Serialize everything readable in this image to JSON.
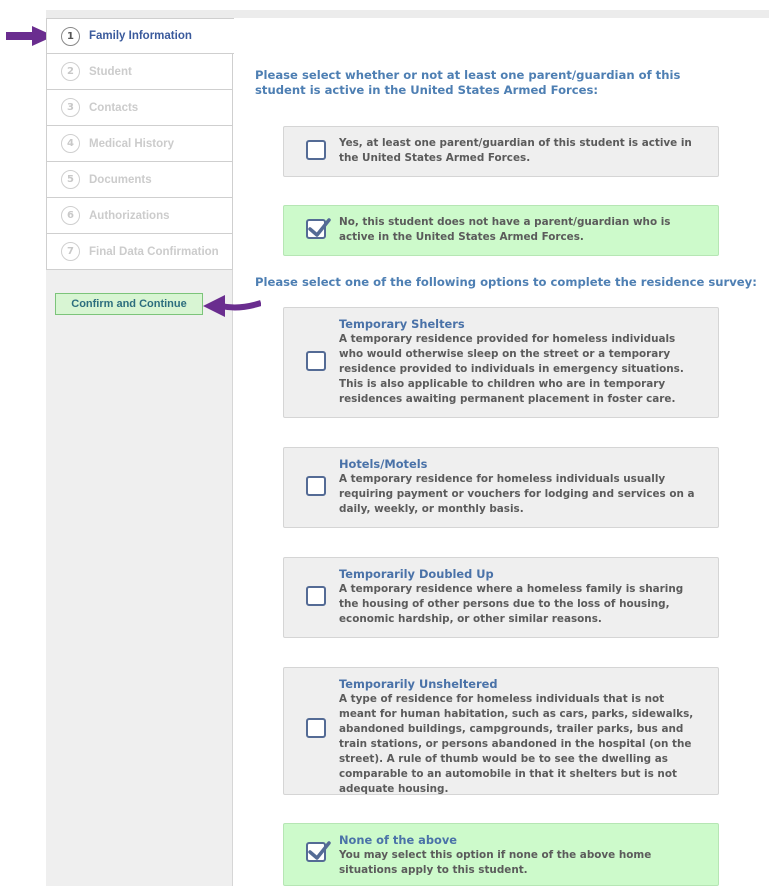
{
  "steps": [
    {
      "num": "1",
      "label": "Family Information",
      "active": true
    },
    {
      "num": "2",
      "label": "Student",
      "active": false
    },
    {
      "num": "3",
      "label": "Contacts",
      "active": false
    },
    {
      "num": "4",
      "label": "Medical History",
      "active": false
    },
    {
      "num": "5",
      "label": "Documents",
      "active": false
    },
    {
      "num": "6",
      "label": "Authorizations",
      "active": false
    },
    {
      "num": "7",
      "label": "Final Data Confirmation",
      "active": false
    }
  ],
  "confirm_button": "Confirm and Continue",
  "military": {
    "question": "Please select whether or not at least one parent/guardian of this student is active in the United States Armed Forces:",
    "options": [
      {
        "text": "Yes, at least one parent/guardian of this student is active in the United States Armed Forces.",
        "checked": false
      },
      {
        "text": "No, this student does not have a parent/guardian who is active in the United States Armed Forces.",
        "checked": true
      }
    ]
  },
  "residence": {
    "question": "Please select one of the following options to complete the residence survey:",
    "options": [
      {
        "title": "Temporary Shelters",
        "text": "A temporary residence provided for homeless individuals who would otherwise sleep on the street or a temporary residence provided to individuals in emergency situations. This is also applicable to children who are in temporary residences awaiting permanent placement in foster care.",
        "checked": false
      },
      {
        "title": "Hotels/Motels",
        "text": "A temporary residence for homeless individuals usually requiring payment or vouchers for lodging and services on a daily, weekly, or monthly basis.",
        "checked": false
      },
      {
        "title": "Temporarily Doubled Up",
        "text": "A temporary residence where a homeless family is sharing the housing of other persons due to the loss of housing, economic hardship, or other similar reasons.",
        "checked": false
      },
      {
        "title": "Temporarily Unsheltered",
        "text": "A type of residence for homeless individuals that is not meant for human habitation, such as cars, parks, sidewalks, abandoned buildings, campgrounds, trailer parks, bus and train stations, or persons abandoned in the hospital (on the street). A rule of thumb would be to see the dwelling as comparable to an automobile in that it shelters but is not adequate housing.",
        "checked": false
      },
      {
        "title": "None of the above",
        "text": "You may select this option if none of the above home situations apply to this student.",
        "checked": true
      }
    ]
  },
  "colors": {
    "accent": "#4e7fb3",
    "annotation_arrow": "#6a2d8f",
    "checked_bg": "#cdfacb",
    "checkbox_border": "#546b95"
  },
  "icons": {
    "annotation": "purple-arrow-icon",
    "checkbox": "checkbox-icon",
    "check": "checkmark-icon"
  }
}
